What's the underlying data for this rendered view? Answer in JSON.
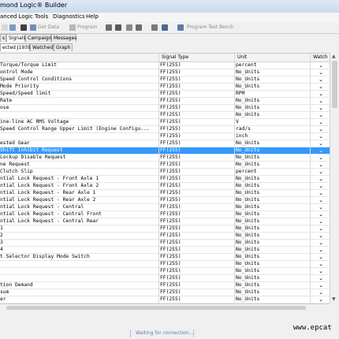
{
  "window": {
    "title": "mond Logic® Builder"
  },
  "menu": {
    "items": [
      "anced Logic",
      "Tools",
      "Diagnostics",
      "Help"
    ]
  },
  "toolbar": {
    "get_data": "Get Data",
    "program": "Program",
    "program_test_bench": "Program Test Bench"
  },
  "tabs_top": [
    "s",
    "Signals",
    "Campaign",
    "Messages"
  ],
  "tabs_sub": [
    "ected J1939",
    "Watched",
    "Graph"
  ],
  "grid": {
    "columns": [
      "Signal Type",
      "Unit",
      "Watch"
    ],
    "rows": [
      {
        "name": "Torque/Torque Limit",
        "type": "FF(255)",
        "unit": "percent"
      },
      {
        "name": "ontrol Mode",
        "type": "FF(255)",
        "unit": "No_Units"
      },
      {
        "name": "Speed Control Conditions",
        "type": "FF(255)",
        "unit": "No_Units"
      },
      {
        "name": "Mode Priority",
        "type": "FF(255)",
        "unit": "No_Units"
      },
      {
        "name": "Speed/Speed limit",
        "type": "FF(255)",
        "unit": "RPM"
      },
      {
        "name": " Rate",
        "type": "FF(255)",
        "unit": "No_Units"
      },
      {
        "name": "ose",
        "type": "FF(255)",
        "unit": "No_Units"
      },
      {
        "name": "",
        "type": "FF(255)",
        "unit": "No_Units"
      },
      {
        "name": "ine-line AC RMS Voltage",
        "type": "FF(255)",
        "unit": "V"
      },
      {
        "name": "Speed Control Range Upper Limit (Engine Configu...",
        "type": "FF(255)",
        "unit": "rad/s"
      },
      {
        "name": "",
        "type": "FF(255)",
        "unit": "inch"
      },
      {
        "name": "ested Gear",
        "type": "FF(255)",
        "unit": "No_Units"
      },
      {
        "name": " Shift Inhibit Request",
        "type": "FF(255)",
        "unit": "No_Units",
        "selected": true
      },
      {
        "name": "Lockup Disable Request",
        "type": "FF(255)",
        "unit": "No_Units"
      },
      {
        "name": "ne Request",
        "type": "FF(255)",
        "unit": "No_Units"
      },
      {
        "name": " Clutch Slip",
        "type": "FF(255)",
        "unit": "percent"
      },
      {
        "name": "ntial Lock Request - Front Axle 1",
        "type": "FF(255)",
        "unit": "No_Units"
      },
      {
        "name": "ntial Lock Request - Front Axle 2",
        "type": "FF(255)",
        "unit": "No_Units"
      },
      {
        "name": "ntial Lock Request - Rear Axle 1",
        "type": "FF(255)",
        "unit": "No_Units"
      },
      {
        "name": "ntial Lock Request - Rear Axle 2",
        "type": "FF(255)",
        "unit": "No_Units"
      },
      {
        "name": "ntial Lock Request - Central",
        "type": "FF(255)",
        "unit": "No_Units"
      },
      {
        "name": "ntial Lock Request - Central Front",
        "type": "FF(255)",
        "unit": "No_Units"
      },
      {
        "name": "ntial Lock Request - Central Rear",
        "type": "FF(255)",
        "unit": "No_Units"
      },
      {
        "name": " 1",
        "type": "FF(255)",
        "unit": "No_Units"
      },
      {
        "name": " 2",
        "type": "FF(255)",
        "unit": "No_Units"
      },
      {
        "name": " 3",
        "type": "FF(255)",
        "unit": "No_Units"
      },
      {
        "name": " 4",
        "type": "FF(255)",
        "unit": "No_Units"
      },
      {
        "name": "t Selector Display Mode Switch",
        "type": "FF(255)",
        "unit": "No_Units"
      },
      {
        "name": "",
        "type": "FF(255)",
        "unit": "No_Units"
      },
      {
        "name": "",
        "type": "FF(255)",
        "unit": "No_Units"
      },
      {
        "name": "",
        "type": "FF(255)",
        "unit": "No_Units"
      },
      {
        "name": "tion Demand",
        "type": "FF(255)",
        "unit": "No_Units"
      },
      {
        "name": "sum",
        "type": "FF(255)",
        "unit": "No_Units"
      },
      {
        "name": "er",
        "type": "FF(255)",
        "unit": "No_Units"
      }
    ]
  },
  "status": {
    "text": "Waiting for connection..."
  },
  "watermark": "www.epcat"
}
